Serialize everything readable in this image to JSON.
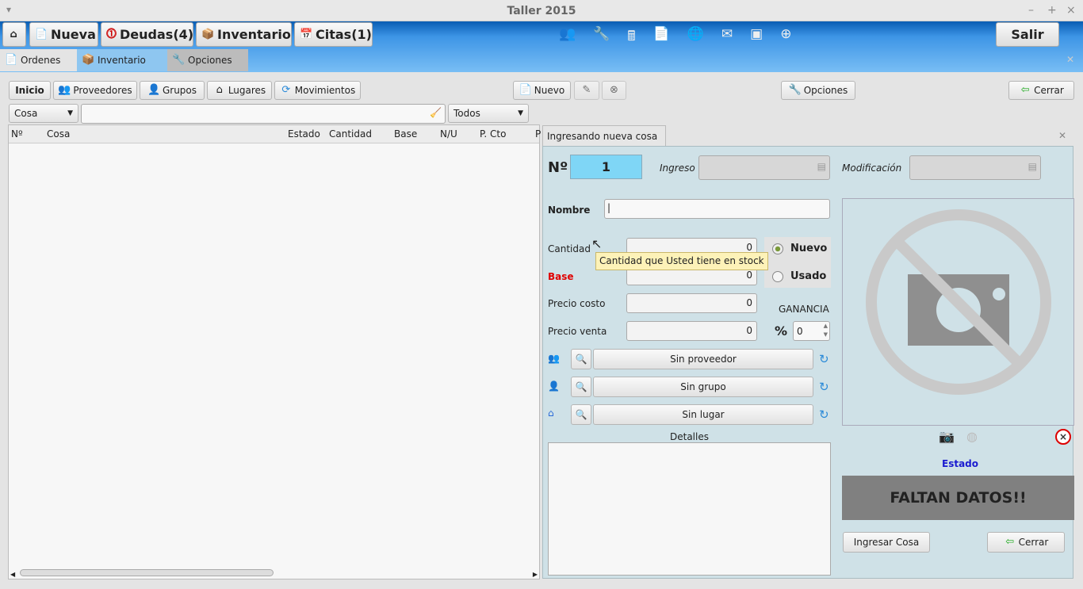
{
  "window": {
    "title": "Taller 2015",
    "minimize": "–",
    "maximize": "+",
    "close": "×"
  },
  "top": {
    "nueva": "Nueva",
    "deudas": "Deudas(4)",
    "inventario": "Inventario",
    "citas": "Citas(1)",
    "salir": "Salir"
  },
  "tabs": [
    {
      "label": "Ordenes"
    },
    {
      "label": "Inventario"
    },
    {
      "label": "Opciones"
    }
  ],
  "toolbar": {
    "inicio": "Inicio",
    "proveedores": "Proveedores",
    "grupos": "Grupos",
    "lugares": "Lugares",
    "movimientos": "Movimientos",
    "nuevo": "Nuevo",
    "opciones": "Opciones",
    "cerrar": "Cerrar"
  },
  "filter": {
    "type": "Cosa",
    "search": "",
    "status": "Todos"
  },
  "table": {
    "columns": [
      "Nº",
      "Cosa",
      "Estado",
      "Cantidad",
      "Base",
      "N/U",
      "P. Cto",
      "P"
    ],
    "rows": []
  },
  "form": {
    "tab": "Ingresando nueva cosa",
    "no_label": "Nº",
    "no_value": "1",
    "ingreso_label": "Ingreso",
    "ingreso_value": "",
    "modificacion_label": "Modificación",
    "modificacion_value": "",
    "nombre_label": "Nombre",
    "nombre_value": "",
    "cantidad_label": "Cantidad",
    "cantidad_value": "0",
    "base_label": "Base",
    "base_value": "0",
    "precio_costo_label": "Precio costo",
    "precio_costo_value": "0",
    "precio_venta_label": "Precio venta",
    "precio_venta_value": "0",
    "nuevo": "Nuevo",
    "usado": "Usado",
    "condition_selected": "Nuevo",
    "ganancia_label": "GANANCIA",
    "pct": "%",
    "ganancia_value": "0",
    "proveedor": "Sin proveedor",
    "grupo": "Sin grupo",
    "lugar": "Sin lugar",
    "detalles_label": "Detalles",
    "detalles_value": "",
    "estado_label": "Estado",
    "estado_value": "FALTAN DATOS!!",
    "ingresar": "Ingresar Cosa",
    "cerrar": "Cerrar"
  },
  "tooltip": "Cantidad que Usted tiene en stock",
  "colors": {
    "base_label": "#e00000",
    "estado_label": "#1a1ad0",
    "panel": "#cfe1e7",
    "no_field": "#7fd6f6"
  }
}
